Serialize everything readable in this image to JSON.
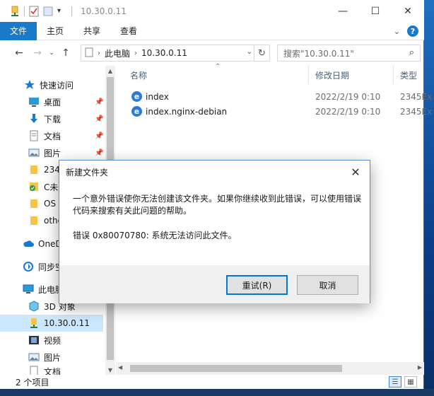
{
  "window": {
    "title": "10.30.0.11",
    "controls": {
      "minimize": "—",
      "maximize": "☐",
      "close": "✕"
    }
  },
  "ribbon": {
    "tabs": [
      {
        "label": "文件",
        "active": true
      },
      {
        "label": "主页",
        "active": false
      },
      {
        "label": "共享",
        "active": false
      },
      {
        "label": "查看",
        "active": false
      }
    ],
    "collapse_icon": "chevron-down-icon",
    "help_label": "?"
  },
  "address": {
    "crumbs": [
      "此电脑",
      "10.30.0.11"
    ]
  },
  "search": {
    "placeholder": "搜索\"10.30.0.11\""
  },
  "nav": {
    "items": [
      {
        "label": "快速访问",
        "icon": "star-icon",
        "pinned": false
      },
      {
        "label": "桌面",
        "icon": "desktop-icon",
        "pinned": true
      },
      {
        "label": "下载",
        "icon": "download-icon",
        "pinned": true
      },
      {
        "label": "文档",
        "icon": "document-icon",
        "pinned": true
      },
      {
        "label": "图片",
        "icon": "picture-icon",
        "pinned": true
      },
      {
        "label": "234",
        "icon": "folder-icon",
        "pinned": false
      },
      {
        "label": "C未",
        "icon": "folder-check-icon",
        "pinned": false
      },
      {
        "label": "OS",
        "icon": "folder-icon",
        "pinned": false
      },
      {
        "label": "othe",
        "icon": "folder-icon",
        "pinned": false
      },
      {
        "label": "OneD",
        "icon": "cloud-icon",
        "pinned": false
      },
      {
        "label": "同步空",
        "icon": "sync-icon",
        "pinned": false
      },
      {
        "label": "此电脑",
        "icon": "computer-icon",
        "pinned": false
      },
      {
        "label": "3D 对象",
        "icon": "cube-icon",
        "pinned": false
      },
      {
        "label": "10.30.0.11",
        "icon": "network-folder-icon",
        "pinned": false,
        "selected": true
      },
      {
        "label": "视频",
        "icon": "video-icon",
        "pinned": false
      },
      {
        "label": "图片",
        "icon": "picture-icon",
        "pinned": false
      },
      {
        "label": "文档",
        "icon": "document-icon",
        "pinned": false
      }
    ]
  },
  "files": {
    "columns": {
      "name": "名称",
      "date": "修改日期",
      "type": "类型"
    },
    "rows": [
      {
        "name": "index",
        "date": "2022/2/19 0:10",
        "type": "2345Ex"
      },
      {
        "name": "index.nginx-debian",
        "date": "2022/2/19 0:10",
        "type": "2345Ex"
      }
    ]
  },
  "status": {
    "count": "2 个项目"
  },
  "dialog": {
    "title": "新建文件夹",
    "message_line1": "一个意外错误使你无法创建该文件夹。如果你继续收到此错误，可以使用错误",
    "message_line2": "代码来搜索有关此问题的帮助。",
    "error": "错误 0x80070780: 系统无法访问此文件。",
    "retry_label": "重试(R)",
    "cancel_label": "取消"
  },
  "colors": {
    "accent": "#1979ca",
    "selection": "#cce8ff"
  }
}
